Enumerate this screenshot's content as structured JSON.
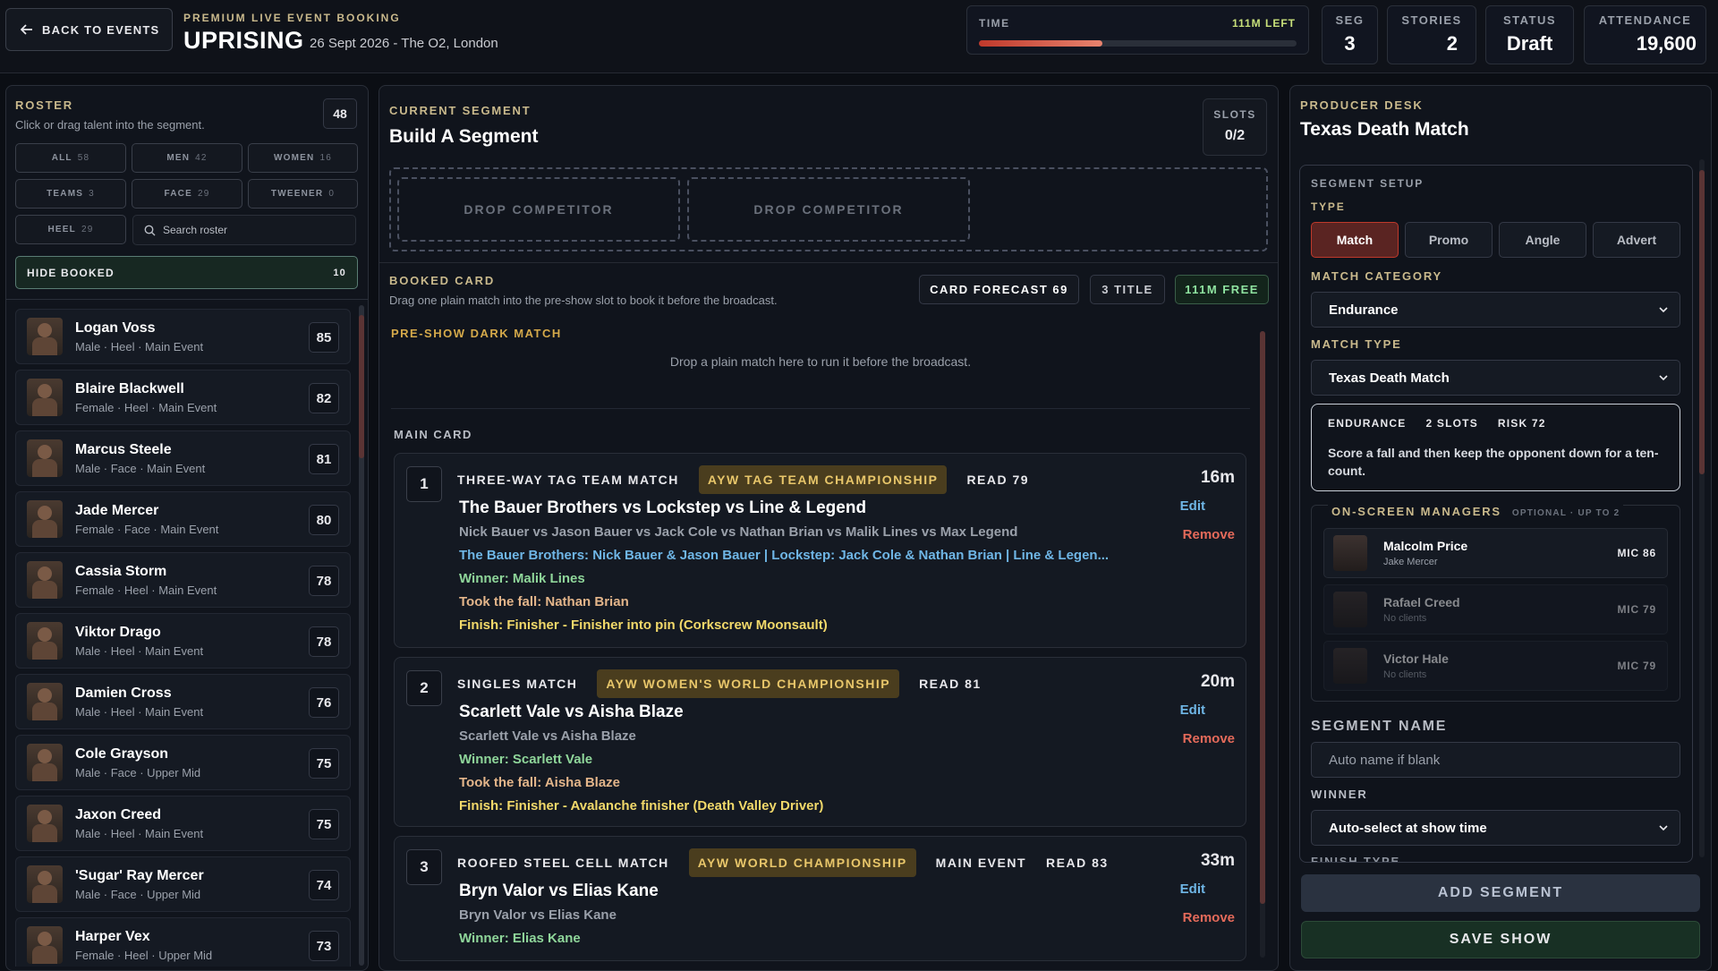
{
  "header": {
    "back_label": "BACK TO EVENTS",
    "eyebrow": "PREMIUM LIVE EVENT BOOKING",
    "title": "UPRISING",
    "subtitle": "26 Sept 2026 - The O2, London",
    "time": {
      "label": "TIME",
      "left": "111M LEFT",
      "progress": 0.39
    },
    "stats": [
      {
        "label": "SEG",
        "value": "3"
      },
      {
        "label": "STORIES",
        "value": "2"
      },
      {
        "label": "STATUS",
        "value": "Draft"
      },
      {
        "label": "ATTENDANCE",
        "value": "19,600"
      }
    ]
  },
  "roster": {
    "heading": "ROSTER",
    "hint": "Click or drag talent into the segment.",
    "count": "48",
    "filters": [
      {
        "label": "ALL",
        "count": "58"
      },
      {
        "label": "MEN",
        "count": "42"
      },
      {
        "label": "WOMEN",
        "count": "16"
      },
      {
        "label": "TEAMS",
        "count": "3"
      },
      {
        "label": "FACE",
        "count": "29"
      },
      {
        "label": "TWEENER",
        "count": "0"
      },
      {
        "label": "HEEL",
        "count": "29"
      }
    ],
    "search_placeholder": "Search roster",
    "hide_booked": {
      "label": "HIDE BOOKED",
      "count": "10"
    },
    "wrestlers": [
      {
        "name": "Logan Voss",
        "meta": "Male · Heel · Main Event",
        "ovr": "85"
      },
      {
        "name": "Blaire Blackwell",
        "meta": "Female · Heel · Main Event",
        "ovr": "82"
      },
      {
        "name": "Marcus Steele",
        "meta": "Male · Face · Main Event",
        "ovr": "81"
      },
      {
        "name": "Jade Mercer",
        "meta": "Female · Face · Main Event",
        "ovr": "80"
      },
      {
        "name": "Cassia Storm",
        "meta": "Female · Heel · Main Event",
        "ovr": "78"
      },
      {
        "name": "Viktor Drago",
        "meta": "Male · Heel · Main Event",
        "ovr": "78"
      },
      {
        "name": "Damien Cross",
        "meta": "Male · Heel · Main Event",
        "ovr": "76"
      },
      {
        "name": "Cole Grayson",
        "meta": "Male · Face · Upper Mid",
        "ovr": "75"
      },
      {
        "name": "Jaxon Creed",
        "meta": "Male · Heel · Main Event",
        "ovr": "75"
      },
      {
        "name": "'Sugar' Ray Mercer",
        "meta": "Male · Face · Upper Mid",
        "ovr": "74"
      },
      {
        "name": "Harper Vex",
        "meta": "Female · Heel · Upper Mid",
        "ovr": "73"
      }
    ]
  },
  "segment": {
    "heading": "CURRENT SEGMENT",
    "title": "Build A Segment",
    "slots_label": "SLOTS",
    "slots_value": "0/2",
    "drop_label": "DROP COMPETITOR"
  },
  "booked": {
    "heading": "BOOKED CARD",
    "hint": "Drag one plain match into the pre-show slot to book it before the broadcast.",
    "forecast": "CARD FORECAST 69",
    "titles": "3 TITLE",
    "free": "111M FREE",
    "preshow_heading": "PRE-SHOW DARK MATCH",
    "preshow_hint": "Drop a plain match here to run it before the broadcast.",
    "main_card_heading": "MAIN CARD",
    "edit_label": "Edit",
    "remove_label": "Remove",
    "segments": [
      {
        "num": "1",
        "type": "THREE-WAY TAG TEAM MATCH",
        "title_badge": "AYW TAG TEAM CHAMPIONSHIP",
        "extra": "",
        "read": "READ 79",
        "duration": "16m",
        "title": "The Bauer Brothers vs Lockstep vs Line & Legend",
        "names": "Nick Bauer vs Jason Bauer vs Jack Cole vs Nathan Brian vs Malik Lines vs Max Legend",
        "teams": "The Bauer Brothers: Nick Bauer & Jason Bauer | Lockstep: Jack Cole & Nathan Brian | Line & Legen...",
        "winner": "Winner: Malik Lines",
        "fall": "Took the fall: Nathan Brian",
        "finish": "Finish: Finisher - Finisher into pin (Corkscrew Moonsault)"
      },
      {
        "num": "2",
        "type": "SINGLES MATCH",
        "title_badge": "AYW WOMEN'S WORLD CHAMPIONSHIP",
        "extra": "",
        "read": "READ 81",
        "duration": "20m",
        "title": "Scarlett Vale vs Aisha Blaze",
        "names": "Scarlett Vale vs Aisha Blaze",
        "winner": "Winner: Scarlett Vale",
        "fall": "Took the fall: Aisha Blaze",
        "finish": "Finish: Finisher - Avalanche finisher (Death Valley Driver)"
      },
      {
        "num": "3",
        "type": "ROOFED STEEL CELL MATCH",
        "title_badge": "AYW WORLD CHAMPIONSHIP",
        "extra": "MAIN EVENT",
        "read": "READ 83",
        "duration": "33m",
        "title": "Bryn Valor vs Elias Kane",
        "names": "Bryn Valor vs Elias Kane",
        "winner": "Winner: Elias Kane"
      }
    ]
  },
  "producer": {
    "heading": "PRODUCER DESK",
    "title": "Texas Death Match",
    "setup_heading": "SEGMENT SETUP",
    "type_label": "TYPE",
    "types": [
      "Match",
      "Promo",
      "Angle",
      "Advert"
    ],
    "category_label": "MATCH CATEGORY",
    "category_value": "Endurance",
    "match_type_label": "MATCH TYPE",
    "match_type_value": "Texas Death Match",
    "info": {
      "tag1": "ENDURANCE",
      "tag2": "2 SLOTS",
      "tag3": "RISK 72",
      "text": "Score a fall and then keep the opponent down for a ten-count."
    },
    "managers_heading": "ON-SCREEN MANAGERS",
    "managers_hint": "OPTIONAL · UP TO 2",
    "managers": [
      {
        "name": "Malcolm Price",
        "clients": "Jake Mercer",
        "mic": "MIC 86"
      },
      {
        "name": "Rafael Creed",
        "clients": "No clients",
        "mic": "MIC 79"
      },
      {
        "name": "Victor Hale",
        "clients": "No clients",
        "mic": "MIC 79"
      }
    ],
    "name_label": "SEGMENT NAME",
    "name_placeholder": "Auto name if blank",
    "winner_label": "WINNER",
    "winner_value": "Auto-select at show time",
    "finish_label": "FINISH TYPE",
    "add_label": "ADD SEGMENT",
    "save_label": "SAVE SHOW"
  },
  "colors": {
    "accent_red": "#c0392b",
    "gold": "#c9b98c",
    "green": "#8fd69a",
    "blue": "#6fb6e6"
  }
}
